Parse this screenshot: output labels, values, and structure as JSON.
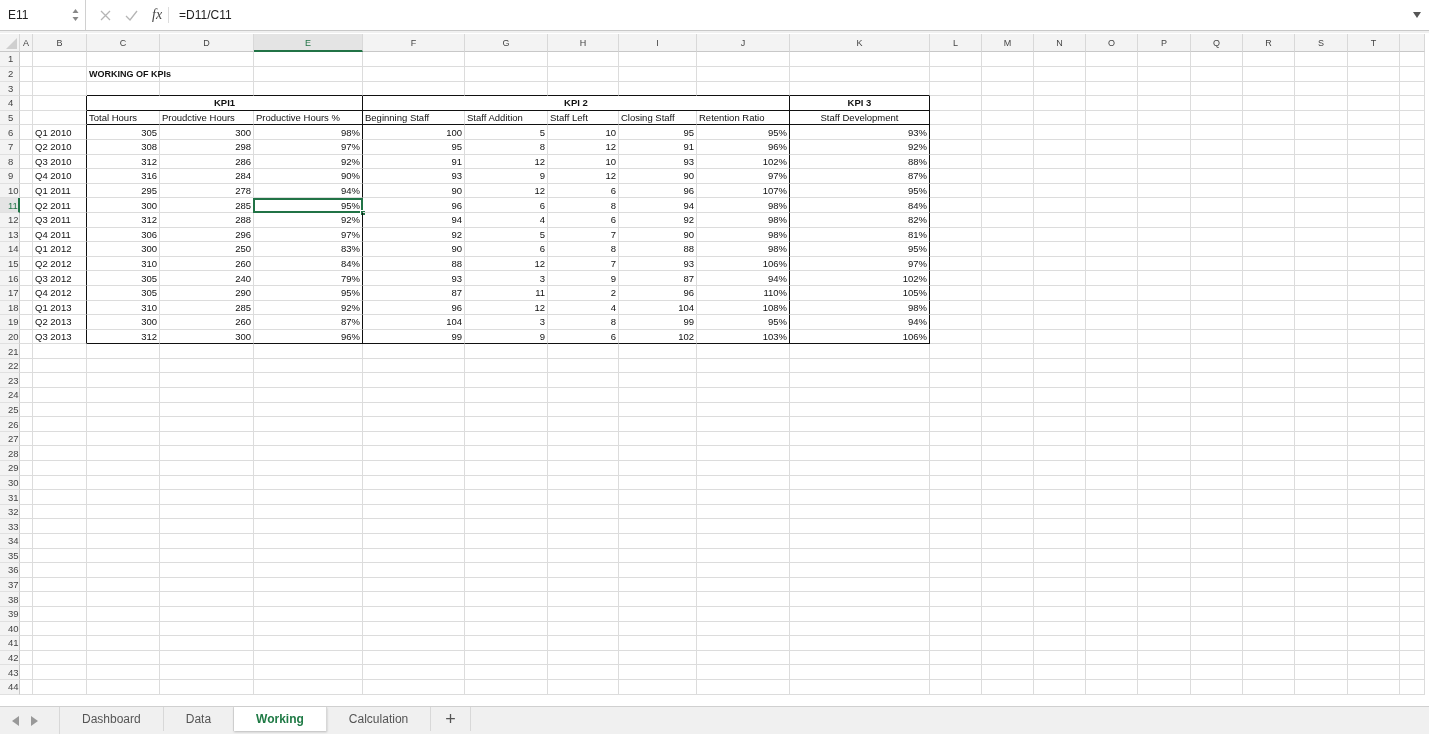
{
  "formula_bar": {
    "name_box": "E11",
    "function_label": "fx",
    "formula": "=D11/C11"
  },
  "columns": [
    {
      "label": "A",
      "selected": false
    },
    {
      "label": "B",
      "selected": false
    },
    {
      "label": "C",
      "selected": false
    },
    {
      "label": "D",
      "selected": false
    },
    {
      "label": "E",
      "selected": true
    },
    {
      "label": "F",
      "selected": false
    },
    {
      "label": "G",
      "selected": false
    },
    {
      "label": "H",
      "selected": false
    },
    {
      "label": "I",
      "selected": false
    },
    {
      "label": "J",
      "selected": false
    },
    {
      "label": "K",
      "selected": false
    },
    {
      "label": "L",
      "selected": false
    },
    {
      "label": "M",
      "selected": false
    },
    {
      "label": "N",
      "selected": false
    },
    {
      "label": "O",
      "selected": false
    },
    {
      "label": "P",
      "selected": false
    },
    {
      "label": "Q",
      "selected": false
    },
    {
      "label": "R",
      "selected": false
    },
    {
      "label": "S",
      "selected": false
    },
    {
      "label": "T",
      "selected": false
    }
  ],
  "rows": [
    {
      "label": "1",
      "selected": false
    },
    {
      "label": "2",
      "selected": false
    },
    {
      "label": "3",
      "selected": false
    },
    {
      "label": "4",
      "selected": false
    },
    {
      "label": "5",
      "selected": false
    },
    {
      "label": "6",
      "selected": false
    },
    {
      "label": "7",
      "selected": false
    },
    {
      "label": "8",
      "selected": false
    },
    {
      "label": "9",
      "selected": false
    },
    {
      "label": "10",
      "selected": false
    },
    {
      "label": "11",
      "selected": true
    },
    {
      "label": "12",
      "selected": false
    },
    {
      "label": "13",
      "selected": false
    },
    {
      "label": "14",
      "selected": false
    },
    {
      "label": "15",
      "selected": false
    },
    {
      "label": "16",
      "selected": false
    },
    {
      "label": "17",
      "selected": false
    },
    {
      "label": "18",
      "selected": false
    },
    {
      "label": "19",
      "selected": false
    },
    {
      "label": "20",
      "selected": false
    },
    {
      "label": "21",
      "selected": false
    },
    {
      "label": "22",
      "selected": false
    },
    {
      "label": "23",
      "selected": false
    },
    {
      "label": "24",
      "selected": false
    },
    {
      "label": "25",
      "selected": false
    },
    {
      "label": "26",
      "selected": false
    },
    {
      "label": "27",
      "selected": false
    },
    {
      "label": "28",
      "selected": false
    },
    {
      "label": "29",
      "selected": false
    },
    {
      "label": "30",
      "selected": false
    },
    {
      "label": "31",
      "selected": false
    },
    {
      "label": "32",
      "selected": false
    },
    {
      "label": "33",
      "selected": false
    },
    {
      "label": "34",
      "selected": false
    },
    {
      "label": "35",
      "selected": false
    },
    {
      "label": "36",
      "selected": false
    },
    {
      "label": "37",
      "selected": false
    },
    {
      "label": "38",
      "selected": false
    },
    {
      "label": "39",
      "selected": false
    },
    {
      "label": "40",
      "selected": false
    },
    {
      "label": "41",
      "selected": false
    },
    {
      "label": "42",
      "selected": false
    },
    {
      "label": "43",
      "selected": false
    },
    {
      "label": "44",
      "selected": false
    }
  ],
  "kpi_table": {
    "title": "WORKING OF KPIs",
    "groups": [
      {
        "label": "KPI1",
        "headers": [
          "Total Hours",
          "Proudctive Hours",
          "Productive Hours %"
        ]
      },
      {
        "label": "KPI 2",
        "headers": [
          "Beginning Staff",
          "Staff Addition",
          "Staff Left",
          "Closing Staff",
          "Retention Ratio"
        ]
      },
      {
        "label": "KPI 3",
        "headers": [
          "Staff Development"
        ]
      }
    ],
    "rows": [
      {
        "period": "Q1 2010",
        "cells": [
          {
            "text": "305",
            "selected": false
          },
          {
            "text": "300",
            "selected": false
          },
          {
            "text": "98%",
            "selected": false
          },
          {
            "text": "100",
            "selected": false
          },
          {
            "text": "5",
            "selected": false
          },
          {
            "text": "10",
            "selected": false
          },
          {
            "text": "95",
            "selected": false
          },
          {
            "text": "95%",
            "selected": false
          },
          {
            "text": "93%",
            "selected": false
          }
        ]
      },
      {
        "period": "Q2 2010",
        "cells": [
          {
            "text": "308",
            "selected": false
          },
          {
            "text": "298",
            "selected": false
          },
          {
            "text": "97%",
            "selected": false
          },
          {
            "text": "95",
            "selected": false
          },
          {
            "text": "8",
            "selected": false
          },
          {
            "text": "12",
            "selected": false
          },
          {
            "text": "91",
            "selected": false
          },
          {
            "text": "96%",
            "selected": false
          },
          {
            "text": "92%",
            "selected": false
          }
        ]
      },
      {
        "period": "Q3 2010",
        "cells": [
          {
            "text": "312",
            "selected": false
          },
          {
            "text": "286",
            "selected": false
          },
          {
            "text": "92%",
            "selected": false
          },
          {
            "text": "91",
            "selected": false
          },
          {
            "text": "12",
            "selected": false
          },
          {
            "text": "10",
            "selected": false
          },
          {
            "text": "93",
            "selected": false
          },
          {
            "text": "102%",
            "selected": false
          },
          {
            "text": "88%",
            "selected": false
          }
        ]
      },
      {
        "period": "Q4 2010",
        "cells": [
          {
            "text": "316",
            "selected": false
          },
          {
            "text": "284",
            "selected": false
          },
          {
            "text": "90%",
            "selected": false
          },
          {
            "text": "93",
            "selected": false
          },
          {
            "text": "9",
            "selected": false
          },
          {
            "text": "12",
            "selected": false
          },
          {
            "text": "90",
            "selected": false
          },
          {
            "text": "97%",
            "selected": false
          },
          {
            "text": "87%",
            "selected": false
          }
        ]
      },
      {
        "period": "Q1 2011",
        "cells": [
          {
            "text": "295",
            "selected": false
          },
          {
            "text": "278",
            "selected": false
          },
          {
            "text": "94%",
            "selected": false
          },
          {
            "text": "90",
            "selected": false
          },
          {
            "text": "12",
            "selected": false
          },
          {
            "text": "6",
            "selected": false
          },
          {
            "text": "96",
            "selected": false
          },
          {
            "text": "107%",
            "selected": false
          },
          {
            "text": "95%",
            "selected": false
          }
        ]
      },
      {
        "period": "Q2 2011",
        "cells": [
          {
            "text": "300",
            "selected": false
          },
          {
            "text": "285",
            "selected": false
          },
          {
            "text": "95%",
            "selected": true
          },
          {
            "text": "96",
            "selected": false
          },
          {
            "text": "6",
            "selected": false
          },
          {
            "text": "8",
            "selected": false
          },
          {
            "text": "94",
            "selected": false
          },
          {
            "text": "98%",
            "selected": false
          },
          {
            "text": "84%",
            "selected": false
          }
        ]
      },
      {
        "period": "Q3 2011",
        "cells": [
          {
            "text": "312",
            "selected": false
          },
          {
            "text": "288",
            "selected": false
          },
          {
            "text": "92%",
            "selected": false
          },
          {
            "text": "94",
            "selected": false
          },
          {
            "text": "4",
            "selected": false
          },
          {
            "text": "6",
            "selected": false
          },
          {
            "text": "92",
            "selected": false
          },
          {
            "text": "98%",
            "selected": false
          },
          {
            "text": "82%",
            "selected": false
          }
        ]
      },
      {
        "period": "Q4 2011",
        "cells": [
          {
            "text": "306",
            "selected": false
          },
          {
            "text": "296",
            "selected": false
          },
          {
            "text": "97%",
            "selected": false
          },
          {
            "text": "92",
            "selected": false
          },
          {
            "text": "5",
            "selected": false
          },
          {
            "text": "7",
            "selected": false
          },
          {
            "text": "90",
            "selected": false
          },
          {
            "text": "98%",
            "selected": false
          },
          {
            "text": "81%",
            "selected": false
          }
        ]
      },
      {
        "period": "Q1 2012",
        "cells": [
          {
            "text": "300",
            "selected": false
          },
          {
            "text": "250",
            "selected": false
          },
          {
            "text": "83%",
            "selected": false
          },
          {
            "text": "90",
            "selected": false
          },
          {
            "text": "6",
            "selected": false
          },
          {
            "text": "8",
            "selected": false
          },
          {
            "text": "88",
            "selected": false
          },
          {
            "text": "98%",
            "selected": false
          },
          {
            "text": "95%",
            "selected": false
          }
        ]
      },
      {
        "period": "Q2 2012",
        "cells": [
          {
            "text": "310",
            "selected": false
          },
          {
            "text": "260",
            "selected": false
          },
          {
            "text": "84%",
            "selected": false
          },
          {
            "text": "88",
            "selected": false
          },
          {
            "text": "12",
            "selected": false
          },
          {
            "text": "7",
            "selected": false
          },
          {
            "text": "93",
            "selected": false
          },
          {
            "text": "106%",
            "selected": false
          },
          {
            "text": "97%",
            "selected": false
          }
        ]
      },
      {
        "period": "Q3 2012",
        "cells": [
          {
            "text": "305",
            "selected": false
          },
          {
            "text": "240",
            "selected": false
          },
          {
            "text": "79%",
            "selected": false
          },
          {
            "text": "93",
            "selected": false
          },
          {
            "text": "3",
            "selected": false
          },
          {
            "text": "9",
            "selected": false
          },
          {
            "text": "87",
            "selected": false
          },
          {
            "text": "94%",
            "selected": false
          },
          {
            "text": "102%",
            "selected": false
          }
        ]
      },
      {
        "period": "Q4 2012",
        "cells": [
          {
            "text": "305",
            "selected": false
          },
          {
            "text": "290",
            "selected": false
          },
          {
            "text": "95%",
            "selected": false
          },
          {
            "text": "87",
            "selected": false
          },
          {
            "text": "11",
            "selected": false
          },
          {
            "text": "2",
            "selected": false
          },
          {
            "text": "96",
            "selected": false
          },
          {
            "text": "110%",
            "selected": false
          },
          {
            "text": "105%",
            "selected": false
          }
        ]
      },
      {
        "period": "Q1 2013",
        "cells": [
          {
            "text": "310",
            "selected": false
          },
          {
            "text": "285",
            "selected": false
          },
          {
            "text": "92%",
            "selected": false
          },
          {
            "text": "96",
            "selected": false
          },
          {
            "text": "12",
            "selected": false
          },
          {
            "text": "4",
            "selected": false
          },
          {
            "text": "104",
            "selected": false
          },
          {
            "text": "108%",
            "selected": false
          },
          {
            "text": "98%",
            "selected": false
          }
        ]
      },
      {
        "period": "Q2 2013",
        "cells": [
          {
            "text": "300",
            "selected": false
          },
          {
            "text": "260",
            "selected": false
          },
          {
            "text": "87%",
            "selected": false
          },
          {
            "text": "104",
            "selected": false
          },
          {
            "text": "3",
            "selected": false
          },
          {
            "text": "8",
            "selected": false
          },
          {
            "text": "99",
            "selected": false
          },
          {
            "text": "95%",
            "selected": false
          },
          {
            "text": "94%",
            "selected": false
          }
        ]
      },
      {
        "period": "Q3 2013",
        "cells": [
          {
            "text": "312",
            "selected": false
          },
          {
            "text": "300",
            "selected": false
          },
          {
            "text": "96%",
            "selected": false
          },
          {
            "text": "99",
            "selected": false
          },
          {
            "text": "9",
            "selected": false
          },
          {
            "text": "6",
            "selected": false
          },
          {
            "text": "102",
            "selected": false
          },
          {
            "text": "103%",
            "selected": false
          },
          {
            "text": "106%",
            "selected": false
          }
        ]
      }
    ]
  },
  "sheet_tabs": [
    {
      "label": "Dashboard",
      "selected": false
    },
    {
      "label": "Data",
      "selected": false
    },
    {
      "label": "Working",
      "selected": true
    },
    {
      "label": "Calculation",
      "selected": false
    }
  ],
  "add_sheet": "+"
}
